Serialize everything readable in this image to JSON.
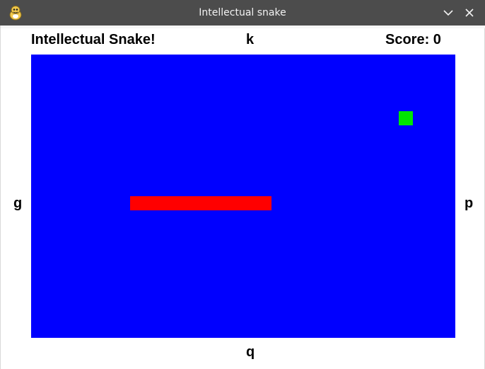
{
  "window": {
    "title": "Intellectual snake",
    "icon": "pygame-snake-icon"
  },
  "titlebar_buttons": {
    "minimize_icon": "chevron-down-icon",
    "close_icon": "close-icon"
  },
  "hud": {
    "title": "Intellectual Snake!",
    "score_label": "Score: 0",
    "key_up": "k",
    "key_left": "g",
    "key_right": "p",
    "key_down": "q"
  },
  "game": {
    "grid_cols": 30,
    "grid_rows": 20,
    "colors": {
      "board": "#0000ff",
      "snake": "#ff0000",
      "food": "#00e600"
    },
    "snake_cells": [
      [
        7,
        10
      ],
      [
        8,
        10
      ],
      [
        9,
        10
      ],
      [
        10,
        10
      ],
      [
        11,
        10
      ],
      [
        12,
        10
      ],
      [
        13,
        10
      ],
      [
        14,
        10
      ],
      [
        15,
        10
      ],
      [
        16,
        10
      ]
    ],
    "food_cell": [
      26,
      4
    ]
  }
}
